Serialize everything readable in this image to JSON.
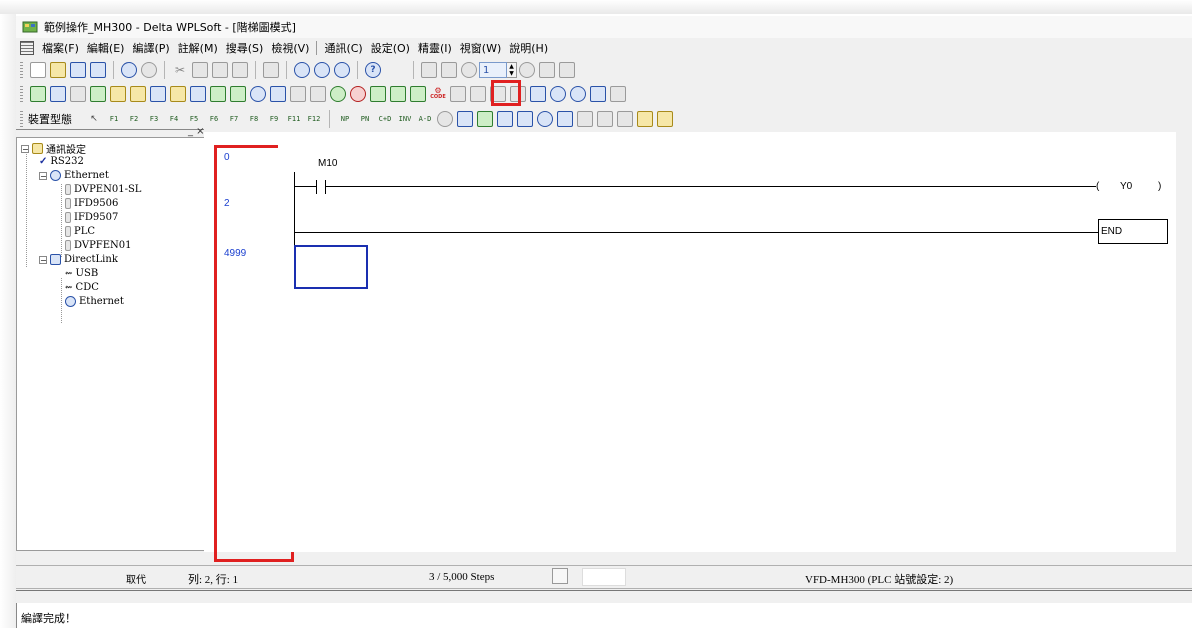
{
  "window": {
    "title": "範例操作_MH300 - Delta WPLSoft - [階梯圖模式]"
  },
  "menu": {
    "items": [
      "檔案(F)",
      "編輯(E)",
      "編譯(P)",
      "註解(M)",
      "搜尋(S)",
      "檢視(V)",
      "通訊(C)",
      "設定(O)",
      "精靈(I)",
      "視窗(W)",
      "說明(H)"
    ]
  },
  "toolbar1": {
    "spin_value": "1"
  },
  "toolbar2": {
    "code_button_label": "CODE"
  },
  "toolbar3": {
    "device_label": "裝置型態",
    "fkeys": [
      "F1",
      "F2",
      "F3",
      "F4",
      "F5",
      "F6",
      "F7",
      "F8",
      "F9",
      "F11",
      "F12"
    ],
    "ext_keys": [
      "NP",
      "PN",
      "C+D",
      "INV",
      "A-D"
    ]
  },
  "tree": {
    "pane_buttons": "_ ×",
    "root": "通訊設定",
    "rs232": "RS232",
    "ethernet": "Ethernet",
    "ethernet_children": [
      "DVPEN01-SL",
      "IFD9506",
      "IFD9507",
      "PLC",
      "DVPFEN01"
    ],
    "directlink": "DirectLink",
    "directlink_children": [
      "USB",
      "CDC",
      "Ethernet"
    ]
  },
  "ladder": {
    "row_numbers": [
      "0",
      "2",
      "4999"
    ],
    "contact_label": "M10",
    "coil_label": "Y0",
    "coil_left": "(",
    "coil_right": ")",
    "end_label": "END"
  },
  "status": {
    "mode": "取代",
    "position": "列: 2, 行: 1",
    "steps": "3 / 5,000 Steps",
    "device": "VFD-MH300 (PLC 站號設定: 2)"
  },
  "output": {
    "message": "編譯完成！"
  },
  "colors": {
    "highlight": "#e02020",
    "row_number": "#1a3fcf",
    "cursor": "#1a2fb0"
  }
}
